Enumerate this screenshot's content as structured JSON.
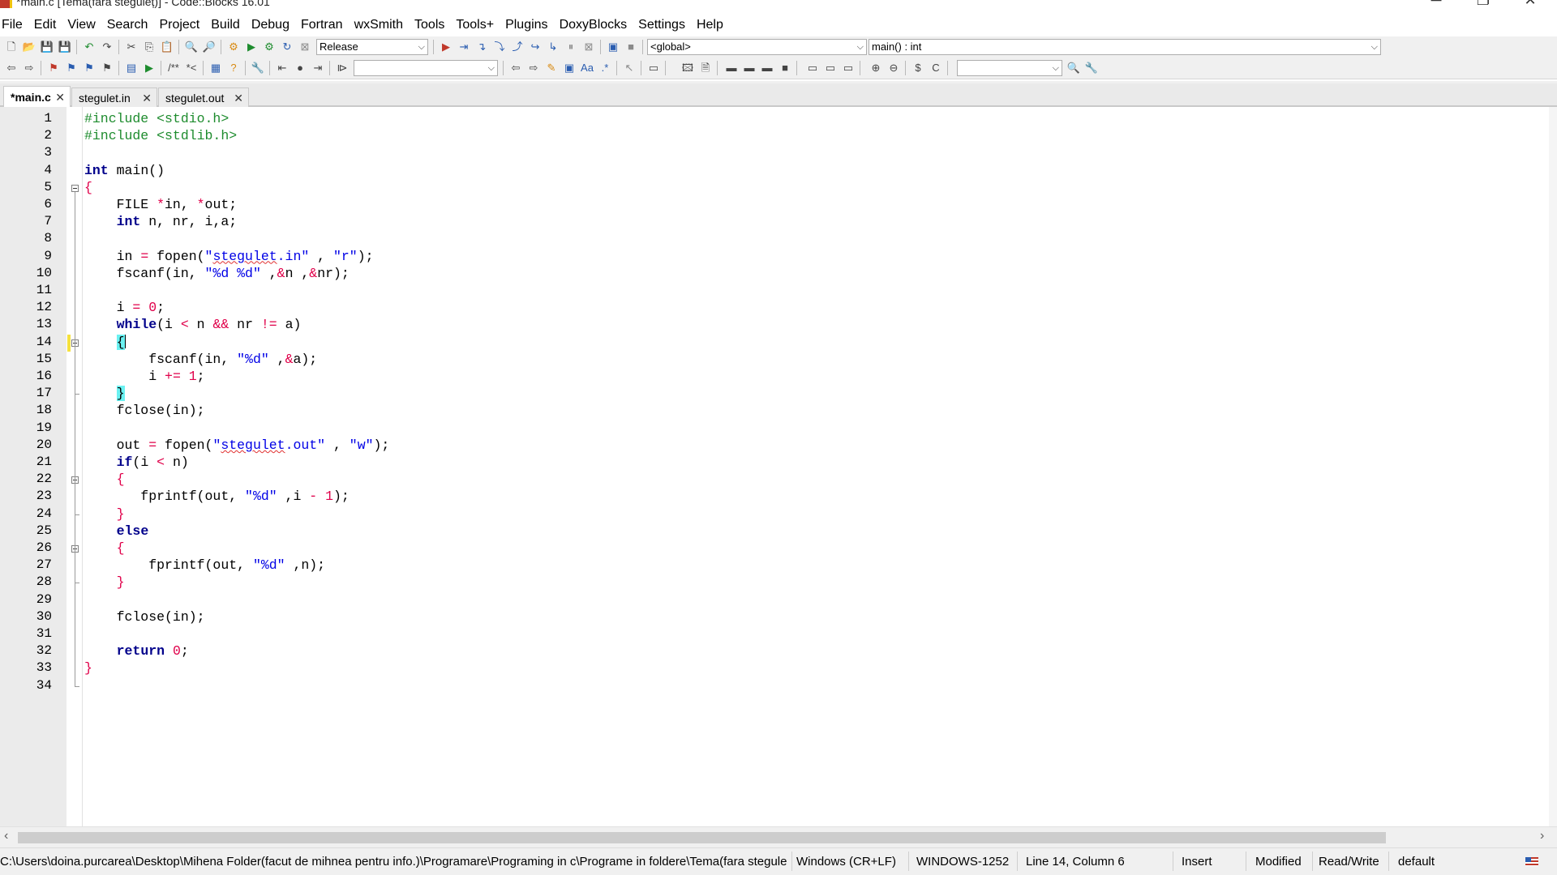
{
  "window": {
    "title": "*main.c [Tema(fara steguleț)] - Code::Blocks 16.01",
    "minimize_glyph": "─",
    "maximize_glyph": "❐",
    "close_glyph": "✕"
  },
  "menu": [
    "File",
    "Edit",
    "View",
    "Search",
    "Project",
    "Build",
    "Debug",
    "Fortran",
    "wxSmith",
    "Tools",
    "Tools+",
    "Plugins",
    "DoxyBlocks",
    "Settings",
    "Help"
  ],
  "toolbar": {
    "build_target": "Release",
    "scope": "<global>",
    "function": "main() : int",
    "search_text": "",
    "find_text": ""
  },
  "tabs": [
    {
      "label": "*main.c",
      "active": true
    },
    {
      "label": "stegulet.in",
      "active": false
    },
    {
      "label": "stegulet.out",
      "active": false
    }
  ],
  "editor": {
    "line_numbers": [
      "1",
      "2",
      "3",
      "4",
      "5",
      "6",
      "7",
      "8",
      "9",
      "10",
      "11",
      "12",
      "13",
      "14",
      "15",
      "16",
      "17",
      "18",
      "19",
      "20",
      "21",
      "22",
      "23",
      "24",
      "25",
      "26",
      "27",
      "28",
      "29",
      "30",
      "31",
      "32",
      "33",
      "34"
    ],
    "lines": [
      "#include <stdio.h>",
      "#include <stdlib.h>",
      "",
      "int main()",
      "{",
      "    FILE *in, *out;",
      "    int n, nr, i,a;",
      "",
      "    in = fopen(\"stegulet.in\" , \"r\");",
      "    fscanf(in, \"%d %d\" ,&n ,&nr);",
      "",
      "    i = 0;",
      "    while(i < n && nr != a)",
      "    {",
      "        fscanf(in, \"%d\" ,&a);",
      "        i += 1;",
      "    }",
      "    fclose(in);",
      "",
      "    out = fopen(\"stegulet.out\" , \"w\");",
      "    if(i < n)",
      "    {",
      "       fprintf(out, \"%d\" ,i - 1);",
      "    }",
      "    else",
      "    {",
      "        fprintf(out, \"%d\" ,n);",
      "    }",
      "",
      "    fclose(in);",
      "",
      "    return 0;",
      "}",
      ""
    ]
  },
  "statusbar": {
    "path": "C:\\Users\\doina.purcarea\\Desktop\\Mihena Folder(facut de mihnea pentru info.)\\Programare\\Programing in c\\Programe in foldere\\Tema(fara stegule",
    "eol": "Windows (CR+LF)",
    "encoding": "WINDOWS-1252",
    "position": "Line 14, Column 6",
    "mode": "Insert",
    "modified": "Modified",
    "access": "Read/Write",
    "profile": "default"
  },
  "colors": {
    "keyword": "#00008b",
    "preprocessor": "#1e8c2e",
    "string": "#0000e6",
    "number": "#e0004a",
    "brace_highlight": "#6bf2f2",
    "change_marker": "#f5e13d"
  }
}
